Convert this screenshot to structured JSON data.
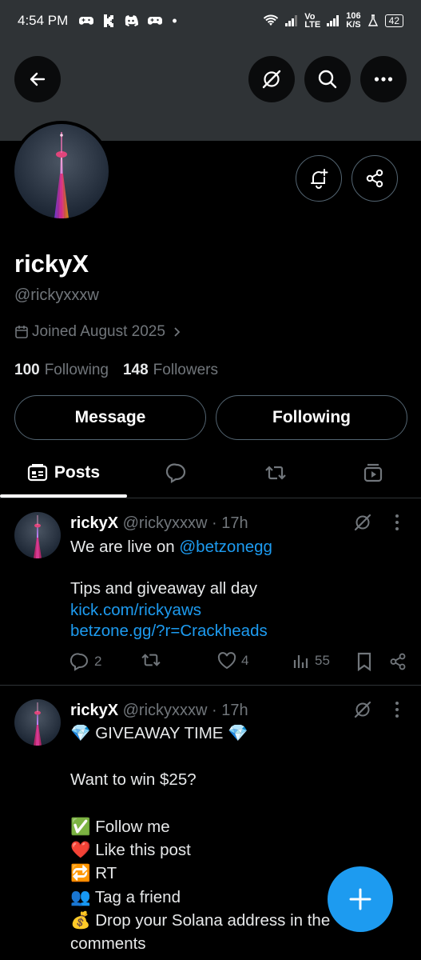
{
  "status_bar": {
    "time": "4:54 PM",
    "app_icons": [
      "gamepad-icon",
      "kick-icon",
      "discord-icon",
      "gamepad-icon",
      "dot"
    ],
    "network_label": "Vo LTE",
    "speed": "106",
    "speed_unit": "K/S",
    "battery": "42"
  },
  "header": {
    "back_icon": "back-arrow-icon",
    "grok_icon": "grok-icon",
    "search_icon": "search-icon",
    "more_icon": "more-icon"
  },
  "profile": {
    "name": "rickyX",
    "handle": "@rickyxxxw",
    "joined": "Joined August 2025",
    "following_count": "100",
    "following_label": "Following",
    "followers_count": "148",
    "followers_label": "Followers",
    "message_button": "Message",
    "following_button": "Following"
  },
  "tabs": [
    {
      "label": "Posts",
      "icon": "posts-icon",
      "active": true
    },
    {
      "label": "",
      "icon": "replies-icon"
    },
    {
      "label": "",
      "icon": "retweet-icon"
    },
    {
      "label": "",
      "icon": "media-icon"
    }
  ],
  "tweets": [
    {
      "name": "rickyX",
      "handle": "@rickyxxxw",
      "time": "· 17h",
      "lines": [
        {
          "text": "We are live on ",
          "link": "@betzonegg"
        },
        {
          "text": ""
        },
        {
          "text": "Tips and giveaway all day"
        },
        {
          "link": "kick.com/rickyaws"
        },
        {
          "link": "betzone.gg/?r=Crackheads"
        }
      ],
      "replies": "2",
      "retweets": "",
      "likes": "4",
      "views": "55"
    },
    {
      "name": "rickyX",
      "handle": "@rickyxxxw",
      "time": "· 17h",
      "lines": [
        {
          "text": "💎 GIVEAWAY TIME 💎"
        },
        {
          "text": ""
        },
        {
          "text": "Want to win $25?"
        },
        {
          "text": ""
        },
        {
          "text": "✅ Follow me"
        },
        {
          "text": "❤️ Like this post"
        },
        {
          "text": "🔁 RT"
        },
        {
          "text": "👥 Tag a friend"
        },
        {
          "text": "💰 Drop your Solana address in the"
        },
        {
          "text": "comments"
        }
      ]
    }
  ],
  "colors": {
    "accent": "#1d9bf0",
    "background": "#000000",
    "banner": "#2f3336",
    "muted": "#71767b"
  }
}
